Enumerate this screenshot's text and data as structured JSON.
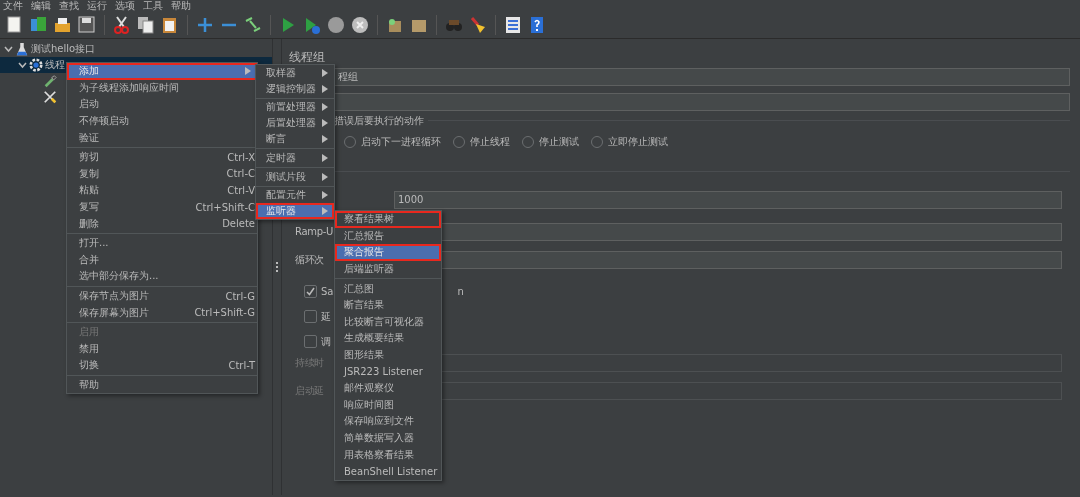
{
  "menu_bar": [
    "文件",
    "编辑",
    "查找",
    "运行",
    "选项",
    "工具",
    "帮助"
  ],
  "tree": [
    {
      "label": "测试hello接口",
      "kind": "flask",
      "expanded": true,
      "selected": false,
      "children": [
        {
          "label": "线程",
          "kind": "gear",
          "expanded": true,
          "selected": true,
          "children": [
            {
              "kind": "pipette",
              "selected": false
            },
            {
              "kind": "tools",
              "selected": false
            }
          ]
        }
      ]
    }
  ],
  "panel": {
    "title": "线程组",
    "name_field": {
      "value": "程组"
    },
    "error_action": {
      "legend": "措误后要执行的动作",
      "options": [
        {
          "label": "启动下一进程循环",
          "selected": false
        },
        {
          "label": "停止线程",
          "selected": false
        },
        {
          "label": "停止测试",
          "selected": false
        },
        {
          "label": "立即停止测试",
          "selected": false
        }
      ]
    },
    "threads_field": {
      "value": "1000"
    },
    "rampup_label": "Ramp-U",
    "loop_label": "循环次",
    "checkboxes": [
      {
        "label": "Sa",
        "tail": "n",
        "checked": true
      },
      {
        "label": "延",
        "checked": false
      },
      {
        "label": "调",
        "checked": false
      }
    ],
    "duration": {
      "label": "持续时",
      "disabled": true
    },
    "delay": {
      "label": "启动延",
      "disabled": true
    }
  },
  "context_menu": {
    "items": [
      {
        "kind": "item",
        "label": "添加",
        "submenu": true,
        "selected": true,
        "highlighted": true
      },
      {
        "kind": "item",
        "label": "为子线程添加响应时间",
        "selected": false
      },
      {
        "kind": "item",
        "label": "启动",
        "selected": false
      },
      {
        "kind": "item",
        "label": "不停顿启动",
        "selected": false
      },
      {
        "kind": "item",
        "label": "验证",
        "selected": false
      },
      {
        "kind": "separator"
      },
      {
        "kind": "item",
        "label": "剪切",
        "shortcut": "Ctrl-X",
        "selected": false
      },
      {
        "kind": "item",
        "label": "复制",
        "shortcut": "Ctrl-C",
        "selected": false
      },
      {
        "kind": "item",
        "label": "粘贴",
        "shortcut": "Ctrl-V",
        "selected": false
      },
      {
        "kind": "item",
        "label": "复写",
        "shortcut": "Ctrl+Shift-C",
        "selected": false
      },
      {
        "kind": "item",
        "label": "删除",
        "shortcut": "Delete",
        "selected": false
      },
      {
        "kind": "separator"
      },
      {
        "kind": "item",
        "label": "打开...",
        "selected": false
      },
      {
        "kind": "item",
        "label": "合并",
        "selected": false
      },
      {
        "kind": "item",
        "label": "选中部分保存为...",
        "selected": false
      },
      {
        "kind": "separator"
      },
      {
        "kind": "item",
        "label": "保存节点为图片",
        "shortcut": "Ctrl-G",
        "selected": false
      },
      {
        "kind": "item",
        "label": "保存屏幕为图片",
        "shortcut": "Ctrl+Shift-G",
        "selected": false
      },
      {
        "kind": "separator"
      },
      {
        "kind": "item",
        "label": "启用",
        "disabled": true,
        "selected": false
      },
      {
        "kind": "item",
        "label": "禁用",
        "selected": false
      },
      {
        "kind": "item",
        "label": "切换",
        "shortcut": "Ctrl-T",
        "selected": false
      },
      {
        "kind": "separator"
      },
      {
        "kind": "item",
        "label": "帮助",
        "selected": false
      }
    ]
  },
  "add_submenu": {
    "items": [
      {
        "kind": "item",
        "label": "取样器",
        "submenu": true,
        "selected": false
      },
      {
        "kind": "item",
        "label": "逻辑控制器",
        "submenu": true,
        "selected": false
      },
      {
        "kind": "separator"
      },
      {
        "kind": "item",
        "label": "前置处理器",
        "submenu": true,
        "selected": false
      },
      {
        "kind": "item",
        "label": "后置处理器",
        "submenu": true,
        "selected": false
      },
      {
        "kind": "item",
        "label": "断言",
        "submenu": true,
        "selected": false
      },
      {
        "kind": "separator"
      },
      {
        "kind": "item",
        "label": "定时器",
        "submenu": true,
        "selected": false
      },
      {
        "kind": "separator"
      },
      {
        "kind": "item",
        "label": "测试片段",
        "submenu": true,
        "selected": false
      },
      {
        "kind": "separator"
      },
      {
        "kind": "item",
        "label": "配置元件",
        "submenu": true,
        "selected": false
      },
      {
        "kind": "item",
        "label": "监听器",
        "submenu": true,
        "selected": true,
        "highlighted": true
      }
    ]
  },
  "listener_submenu": {
    "items": [
      {
        "kind": "item",
        "label": "察看结果树",
        "selected": false,
        "highlighted": true
      },
      {
        "kind": "item",
        "label": "汇总报告",
        "selected": false
      },
      {
        "kind": "item",
        "label": "聚合报告",
        "selected": true,
        "highlighted": true
      },
      {
        "kind": "item",
        "label": "后端监听器",
        "selected": false
      },
      {
        "kind": "separator"
      },
      {
        "kind": "item",
        "label": "汇总图",
        "selected": false
      },
      {
        "kind": "item",
        "label": "断言结果",
        "selected": false
      },
      {
        "kind": "item",
        "label": "比较断言可视化器",
        "selected": false
      },
      {
        "kind": "item",
        "label": "生成概要结果",
        "selected": false
      },
      {
        "kind": "item",
        "label": "图形结果",
        "selected": false
      },
      {
        "kind": "item",
        "label": "JSR223 Listener",
        "selected": false
      },
      {
        "kind": "item",
        "label": "邮件观察仪",
        "selected": false
      },
      {
        "kind": "item",
        "label": "响应时间图",
        "selected": false
      },
      {
        "kind": "item",
        "label": "保存响应到文件",
        "selected": false
      },
      {
        "kind": "item",
        "label": "简单数据写入器",
        "selected": false
      },
      {
        "kind": "item",
        "label": "用表格察看结果",
        "selected": false
      },
      {
        "kind": "item",
        "label": "BeanShell Listener",
        "selected": false
      }
    ]
  }
}
